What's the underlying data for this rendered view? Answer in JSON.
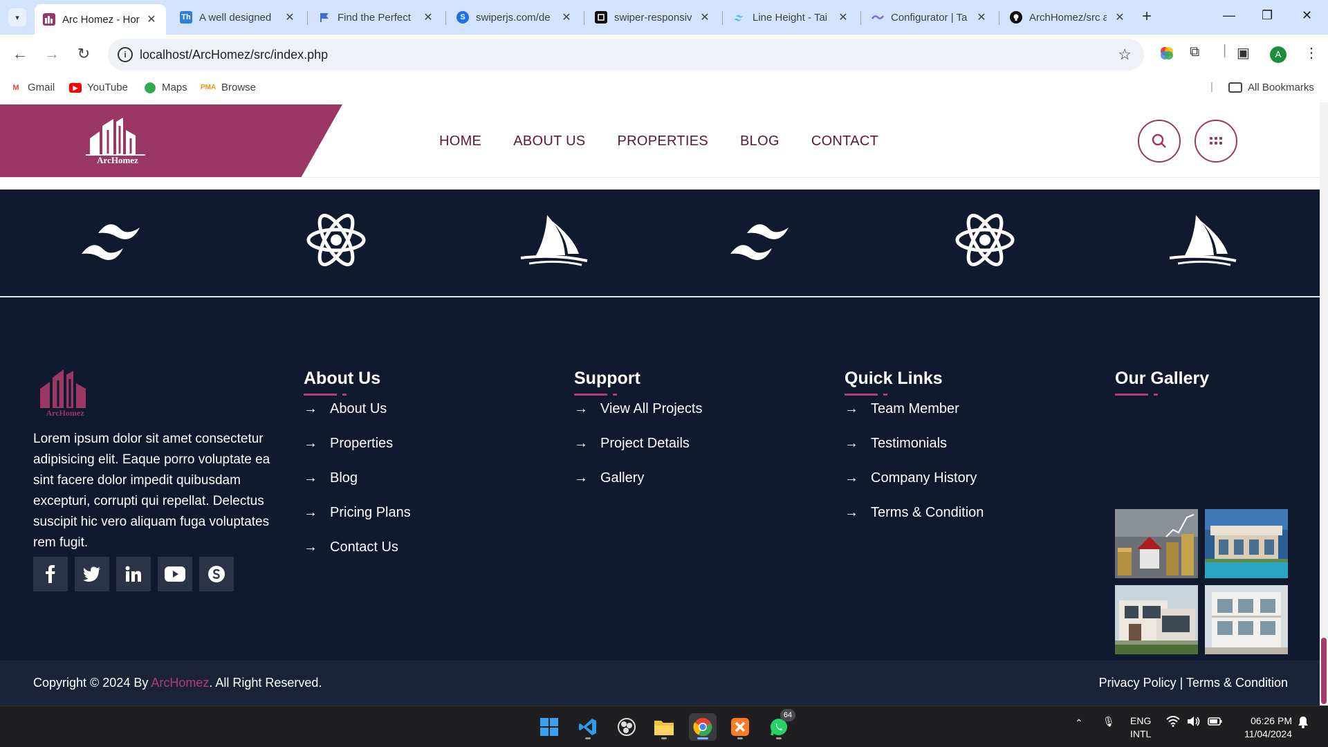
{
  "browser": {
    "tabs": [
      {
        "title": "Arc Homez - Hor",
        "favicon": "archomez-icon",
        "active": true
      },
      {
        "title": "A well designed",
        "favicon": "th-icon",
        "active": false
      },
      {
        "title": "Find the Perfect",
        "favicon": "flag-icon",
        "active": false
      },
      {
        "title": "swiperjs.com/de",
        "favicon": "swiper-icon",
        "active": false
      },
      {
        "title": "swiper-responsiv",
        "favicon": "codesandbox-icon",
        "active": false
      },
      {
        "title": "Line Height - Tai",
        "favicon": "tailwind-icon",
        "active": false
      },
      {
        "title": "Configurator | Ta",
        "favicon": "configurator-icon",
        "active": false
      },
      {
        "title": "ArchHomez/src at",
        "favicon": "github-icon",
        "active": false
      }
    ],
    "url": "localhost/ArcHomez/src/index.php",
    "bookmarks": [
      {
        "label": "Gmail",
        "icon": "gmail-icon"
      },
      {
        "label": "YouTube",
        "icon": "youtube-icon"
      },
      {
        "label": "Maps",
        "icon": "maps-icon"
      },
      {
        "label": "Browse",
        "icon": "pma-icon"
      }
    ],
    "all_bookmarks": "All Bookmarks",
    "profile_initial": "A"
  },
  "site": {
    "logo_text": "ArcHomez",
    "nav": [
      "HOME",
      "ABOUT US",
      "PROPERTIES",
      "BLOG",
      "CONTACT"
    ],
    "brand_strip": [
      "tailwind-icon",
      "react-icon",
      "sailboat-icon",
      "tailwind-icon",
      "react-icon",
      "sailboat-icon"
    ],
    "footer": {
      "logo_text": "ArcHomez",
      "about": "Lorem ipsum dolor sit amet consectetur adipisicing elit. Eaque porro voluptate ea sint facere dolor impedit quibusdam excepturi, corrupti qui repellat. Delectus suscipit hic vero aliquam fuga voluptates rem fugit.",
      "social": [
        "facebook-icon",
        "twitter-icon",
        "linkedin-icon",
        "youtube-icon",
        "skype-icon"
      ],
      "columns": [
        {
          "title": "About Us",
          "links": [
            "About Us",
            "Properties",
            "Blog",
            "Pricing Plans",
            "Contact Us"
          ]
        },
        {
          "title": "Support",
          "links": [
            "View All Projects",
            "Project Details",
            "Gallery"
          ]
        },
        {
          "title": "Quick Links",
          "links": [
            "Team Member",
            "Testimonials",
            "Company History",
            "Terms & Condition"
          ]
        }
      ],
      "gallery_title": "Our Gallery"
    },
    "copyright_prefix": "Copyright © 2024 By ",
    "copyright_brand": "ArcHomez",
    "copyright_suffix": ". All Right Reserved.",
    "copy_right_links": "Privacy Policy | Terms & Condition"
  },
  "taskbar": {
    "apps": [
      "windows-start-icon",
      "vscode-icon",
      "obs-icon",
      "file-explorer-icon",
      "chrome-icon",
      "xampp-icon",
      "whatsapp-icon"
    ],
    "whatsapp_badge": "64",
    "lang_line1": "ENG",
    "lang_line2": "INTL",
    "time": "06:26 PM",
    "date": "11/04/2024"
  },
  "colors": {
    "brand": "#9b3765",
    "dark": "#0f1a2e",
    "accent": "#b23c76"
  }
}
